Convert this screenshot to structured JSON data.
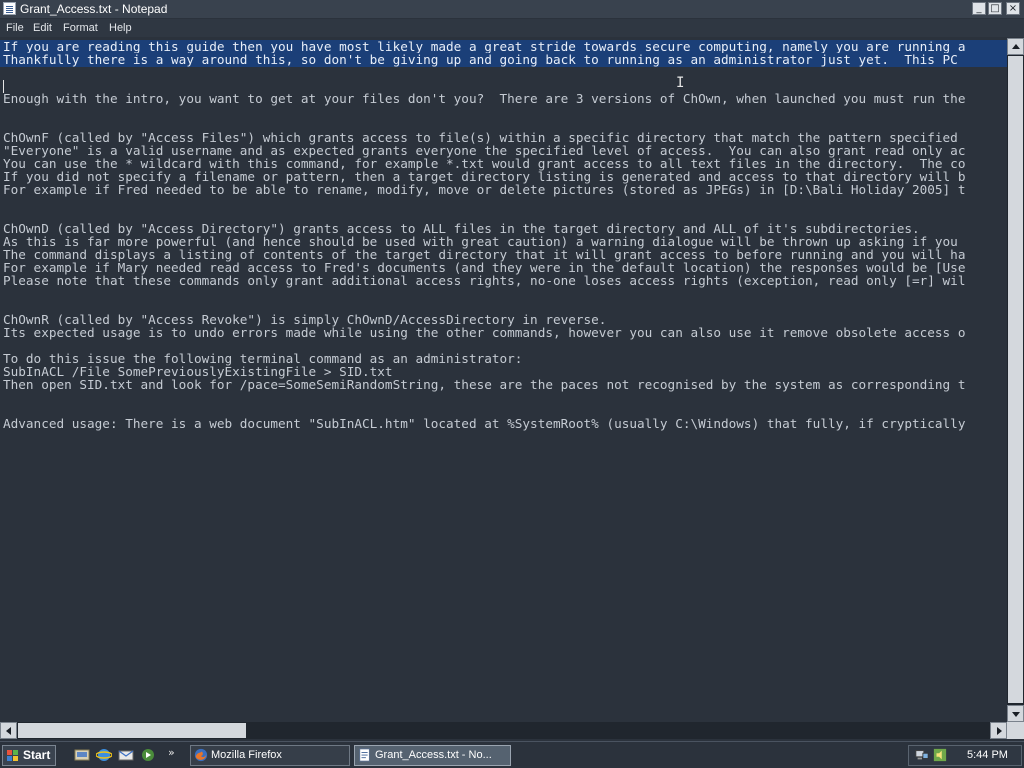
{
  "window": {
    "title": "Grant_Access.txt - Notepad",
    "controls": {
      "minimize": "_",
      "maximize": "□",
      "close": "×"
    }
  },
  "menu": [
    "File",
    "Edit",
    "Format",
    "Help"
  ],
  "document": {
    "lines": [
      "If you are reading this guide then you have most likely made a great stride towards secure computing, namely you are running a",
      "Thankfully there is a way around this, so don't be giving up and going back to running as an administrator just yet.  This PC",
      "",
      "",
      "Enough with the intro, you want to get at your files don't you?  There are 3 versions of ChOwn, when launched you must run the",
      "",
      "",
      "ChOwnF (called by \"Access Files\") which grants access to file(s) within a specific directory that match the pattern specified",
      "\"Everyone\" is a valid username and as expected grants everyone the specified level of access.  You can also grant read only ac",
      "You can use the * wildcard with this command, for example *.txt would grant access to all text files in the directory.  The co",
      "If you did not specify a filename or pattern, then a target directory listing is generated and access to that directory will b",
      "For example if Fred needed to be able to rename, modify, move or delete pictures (stored as JPEGs) in [D:\\Bali Holiday 2005] t",
      "",
      "",
      "ChOwnD (called by \"Access Directory\") grants access to ALL files in the target directory and ALL of it's subdirectories.",
      "As this is far more powerful (and hence should be used with great caution) a warning dialogue will be thrown up asking if you",
      "The command displays a listing of contents of the target directory that it will grant access to before running and you will ha",
      "For example if Mary needed read access to Fred's documents (and they were in the default location) the responses would be [Use",
      "Please note that these commands only grant additional access rights, no-one loses access rights (exception, read only [=r] wil",
      "",
      "",
      "ChOwnR (called by \"Access Revoke\") is simply ChOwnD/AccessDirectory in reverse.",
      "Its expected usage is to undo errors made while using the other commands, however you can also use it remove obsolete access o",
      "",
      "To do this issue the following terminal command as an administrator:",
      "SubInACL /File SomePreviouslyExistingFile > SID.txt",
      "Then open SID.txt and look for /pace=SomeSemiRandomString, these are the paces not recognised by the system as corresponding t",
      "",
      "",
      "Advanced usage: There is a web document \"SubInACL.htm\" located at %SystemRoot% (usually C:\\Windows) that fully, if cryptically"
    ]
  },
  "taskbar": {
    "start_label": "Start",
    "quick_launch_more": "»",
    "tasks": [
      {
        "label": "Mozilla Firefox",
        "active": false
      },
      {
        "label": "Grant_Access.txt - No...",
        "active": true
      }
    ],
    "clock": "5:44 PM"
  },
  "colors": {
    "background": "#2b323c",
    "text": "#c5cbd3",
    "selection": "#1b3f78",
    "titlebar": "#39424e"
  }
}
